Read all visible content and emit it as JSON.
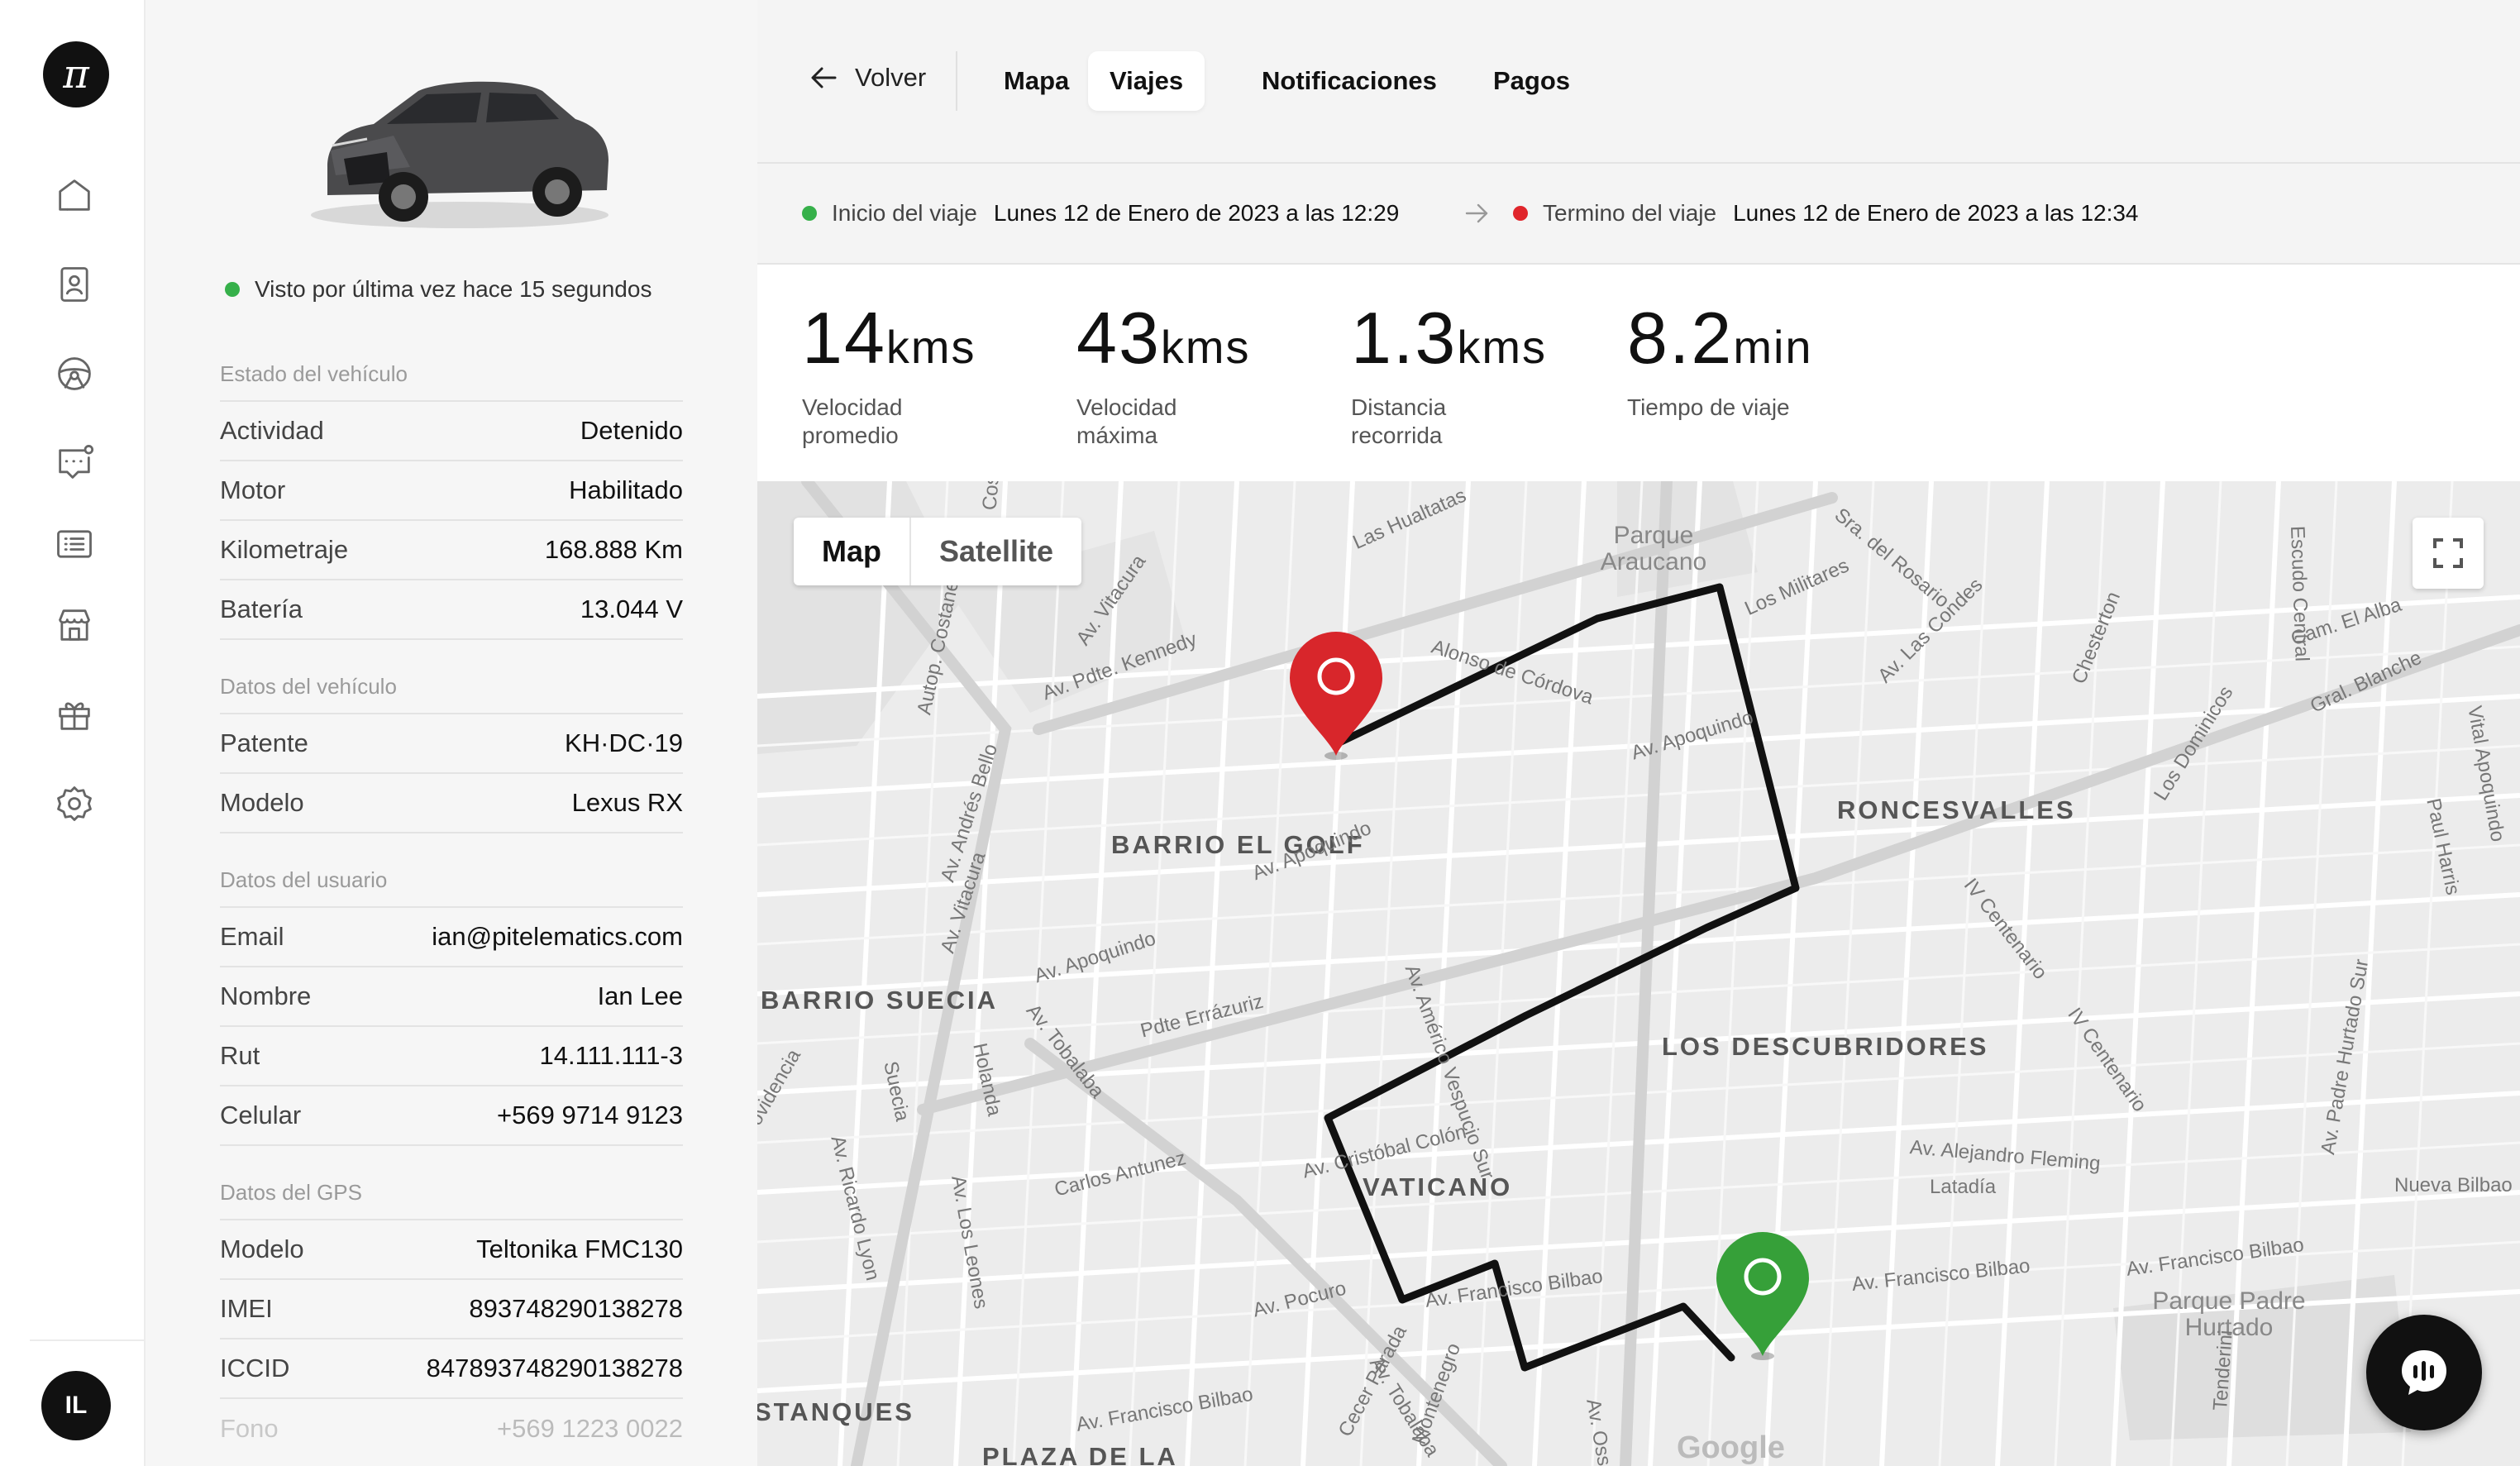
{
  "app": {
    "logo_glyph": "π",
    "user_initials": "IL"
  },
  "sidebar": {
    "icons": [
      "home-icon",
      "contact-card-icon",
      "steering-wheel-icon",
      "chat-notification-icon",
      "list-icon",
      "store-icon",
      "gift-icon",
      "settings-icon"
    ]
  },
  "vehicle": {
    "last_seen": "Visto por última vez hace 15 segundos",
    "estado": {
      "title": "Estado del vehículo",
      "rows": [
        {
          "label": "Actividad",
          "value": "Detenido"
        },
        {
          "label": "Motor",
          "value": "Habilitado"
        },
        {
          "label": "Kilometraje",
          "value": "168.888 Km"
        },
        {
          "label": "Batería",
          "value": "13.044 V"
        }
      ]
    },
    "datos_vehiculo": {
      "title": "Datos del vehículo",
      "rows": [
        {
          "label": "Patente",
          "value": "KH·DC·19"
        },
        {
          "label": "Modelo",
          "value": "Lexus RX"
        }
      ]
    },
    "datos_usuario": {
      "title": "Datos del usuario",
      "rows": [
        {
          "label": "Email",
          "value": "ian@pitelematics.com"
        },
        {
          "label": "Nombre",
          "value": "Ian Lee"
        },
        {
          "label": "Rut",
          "value": "14.111.111-3"
        },
        {
          "label": "Celular",
          "value": "+569 9714 9123"
        }
      ]
    },
    "datos_gps": {
      "title": "Datos del GPS",
      "rows": [
        {
          "label": "Modelo",
          "value": "Teltonika FMC130"
        },
        {
          "label": "IMEI",
          "value": "893748290138278"
        },
        {
          "label": "ICCID",
          "value": "847893748290138278"
        },
        {
          "label": "Fono",
          "value": "+569 1223 0022"
        }
      ]
    }
  },
  "nav": {
    "back_label": "Volver",
    "tabs": [
      {
        "label": "Mapa",
        "active": false
      },
      {
        "label": "Viajes",
        "active": true
      },
      {
        "label": "Notificaciones",
        "active": false
      },
      {
        "label": "Pagos",
        "active": false
      }
    ]
  },
  "trip": {
    "start_label": "Inicio del viaje",
    "start_value": "Lunes 12 de Enero de 2023 a las 12:29",
    "end_label": "Termino del viaje",
    "end_value": "Lunes 12 de Enero de 2023 a las 12:34"
  },
  "stats": [
    {
      "value": "14",
      "unit": "kms",
      "label": "Velocidad promedio"
    },
    {
      "value": "43",
      "unit": "kms",
      "label": "Velocidad máxima"
    },
    {
      "value": "1.3",
      "unit": "kms",
      "label": "Distancia recorrida"
    },
    {
      "value": "8.2",
      "unit": "min",
      "label": "Tiempo de viaje"
    }
  ],
  "map": {
    "type_options": [
      "Map",
      "Satellite"
    ],
    "selected_type": "Map",
    "neighborhoods": [
      "BARRIO EL GOLF",
      "RONCESVALLES",
      "BARRIO SUECIA",
      "LOS DESCUBRIDORES",
      "VATICANO",
      "STANQUES",
      "PLAZA DE LA"
    ],
    "places": [
      "Parque Araucano",
      "Parque Padre Hurtado"
    ],
    "streets": [
      "Av. Pdte. Kennedy",
      "Av. Apoquindo",
      "Av. Apoquindo",
      "Av. Apoquindo",
      "Alonso de Córdova",
      "Av. Las Condes",
      "Los Militares",
      "Sra. del Rosario",
      "Las Hualtatas",
      "Av. Vitacura",
      "Autop. Costanera",
      "Av. Andrés Bello",
      "Av. Vitacura",
      "Av. Tobalaba",
      "Av. Tobalaba",
      "Pdte Errázuriz",
      "Av. Américo Vespucio Sur",
      "Av. Cristóbal Colón",
      "Carlos Antunez",
      "Holanda",
      "Suecia",
      "Av. Ricardo Lyon",
      "Av. Los Leones",
      "Providencia",
      "Av. Pocuro",
      "Av. Francisco Bilbao",
      "Av. Francisco Bilbao",
      "Av. Francisco Bilbao",
      "Av. Francisco Bilbao",
      "Av. Ossa",
      "Av. Alejandro Fleming",
      "Latadía",
      "Nueva Bilbao",
      "IV Centenario",
      "IV Centenario",
      "Chesterton",
      "Cam. El Alba",
      "Gral. Blanche",
      "Los Dominicos",
      "Paul Harris",
      "Av. Padre Hurtado Sur",
      "Vital Apoquindo",
      "Av. Costa",
      "Tenderini",
      "Cecer Parada",
      "Montenegro",
      "Escudo Central"
    ],
    "attribution": "Google"
  },
  "colors": {
    "start_pin": "#36a039",
    "end_pin": "#d8262b",
    "route": "#111111",
    "accent": "#111111"
  }
}
